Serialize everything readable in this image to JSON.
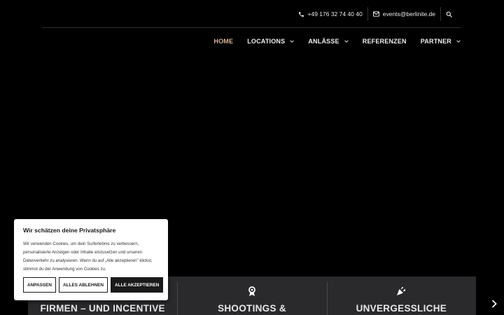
{
  "header": {
    "phone": "+49 176 32 74 40 40",
    "email": "events@berlinite.de"
  },
  "nav": {
    "items": [
      {
        "label": "HOME",
        "active": true,
        "dropdown": false
      },
      {
        "label": "LOCATIONS",
        "active": false,
        "dropdown": true
      },
      {
        "label": "ANLÄSSE",
        "active": false,
        "dropdown": true
      },
      {
        "label": "REFERENZEN",
        "active": false,
        "dropdown": false
      },
      {
        "label": "PARTNER",
        "active": false,
        "dropdown": true
      }
    ]
  },
  "cookie": {
    "title": "Wir schätzen deine Privatsphäre",
    "text": "Wir verwenden Cookies, um dein Surferlebnis zu verbessern, personalisierte Anzeigen oder Inhalte einzusetzen und unseren Datenverkehr zu analysieren. Wenn du auf „Alle akzeptieren\" klickst, stimmst du der Anwendung von Cookies zu.",
    "buttons": {
      "customize": "ANPASSEN",
      "reject": "ALLES ABLEHNEN",
      "accept": "ALLE AKZEPTIEREN"
    }
  },
  "features": [
    {
      "title": "FIRMEN – UND INCENTIVE",
      "icon": "briefcase-icon"
    },
    {
      "title": "SHOOTINGS &",
      "icon": "award-ribbon-icon"
    },
    {
      "title": "UNVERGESSLICHE",
      "icon": "party-popper-icon"
    }
  ],
  "colors": {
    "nav_active": "#d8b49a",
    "feature_bar": "#2a2a2d",
    "background": "#000000"
  }
}
